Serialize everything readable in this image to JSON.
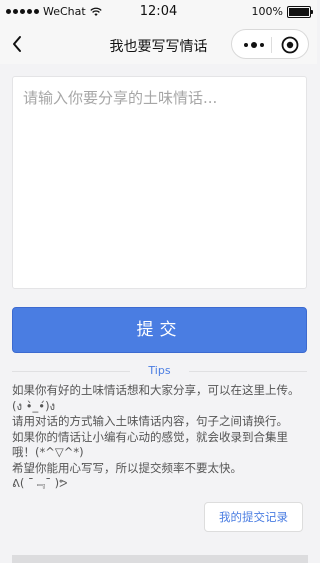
{
  "status_bar": {
    "carrier": "WeChat",
    "time": "12:04",
    "battery": "100%"
  },
  "nav": {
    "title": "我也要写写情话"
  },
  "form": {
    "placeholder": "请输入你要分享的土味情话...",
    "value": "",
    "submit_label": "提交"
  },
  "tips": {
    "title": "Tips",
    "lines": [
      "如果你有好的土味情话想和大家分享，可以在这里上传。(ง •̀_•́)ง",
      "请用对话的方式输入土味情话内容，句子之间请换行。",
      "如果你的情话让小编有心动的感觉，就会收录到合集里哦！(*^▽^*)",
      "希望你能用心写写，所以提交频率不要太快。",
      "ᕕ( ¯̄﹃¯̄ )ᕗ"
    ]
  },
  "records_button": {
    "label": "我的提交记录"
  },
  "colors": {
    "accent": "#4a7de2",
    "background": "#f3f3f5"
  },
  "icons": {
    "back": "chevron-left-icon",
    "more": "more-dots-icon",
    "close": "target-close-icon"
  }
}
